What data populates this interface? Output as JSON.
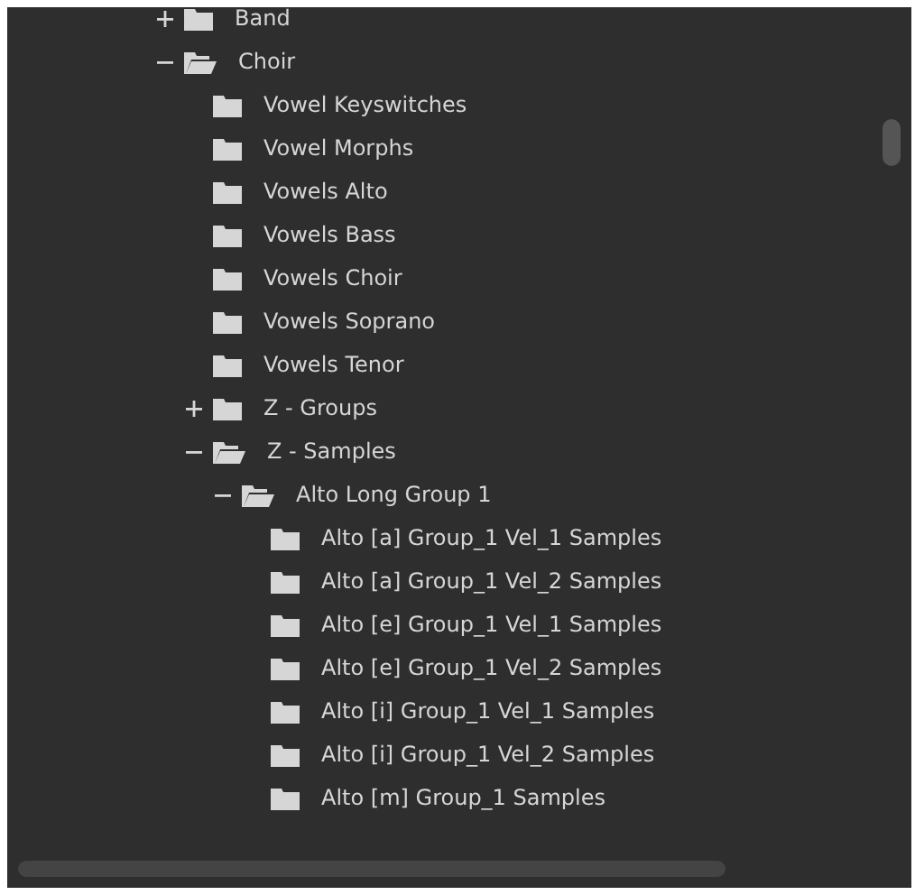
{
  "tree": [
    {
      "label": "Band",
      "expanded": false
    },
    {
      "label": "Choir",
      "expanded": true,
      "children": [
        {
          "label": "Vowel Keyswitches"
        },
        {
          "label": "Vowel Morphs"
        },
        {
          "label": "Vowels Alto"
        },
        {
          "label": "Vowels Bass"
        },
        {
          "label": "Vowels Choir"
        },
        {
          "label": "Vowels Soprano"
        },
        {
          "label": "Vowels Tenor"
        },
        {
          "label": "Z - Groups",
          "expanded": false
        },
        {
          "label": "Z - Samples",
          "expanded": true,
          "children": [
            {
              "label": "Alto Long Group 1",
              "expanded": true,
              "children": [
                {
                  "label": "Alto [a] Group_1 Vel_1 Samples"
                },
                {
                  "label": "Alto [a] Group_1 Vel_2 Samples"
                },
                {
                  "label": "Alto [e] Group_1 Vel_1 Samples"
                },
                {
                  "label": "Alto [e] Group_1 Vel_2 Samples"
                },
                {
                  "label": "Alto [i] Group_1 Vel_1 Samples"
                },
                {
                  "label": "Alto [i] Group_1 Vel_2 Samples"
                },
                {
                  "label": "Alto [m] Group_1 Samples"
                }
              ]
            }
          ]
        }
      ]
    }
  ]
}
